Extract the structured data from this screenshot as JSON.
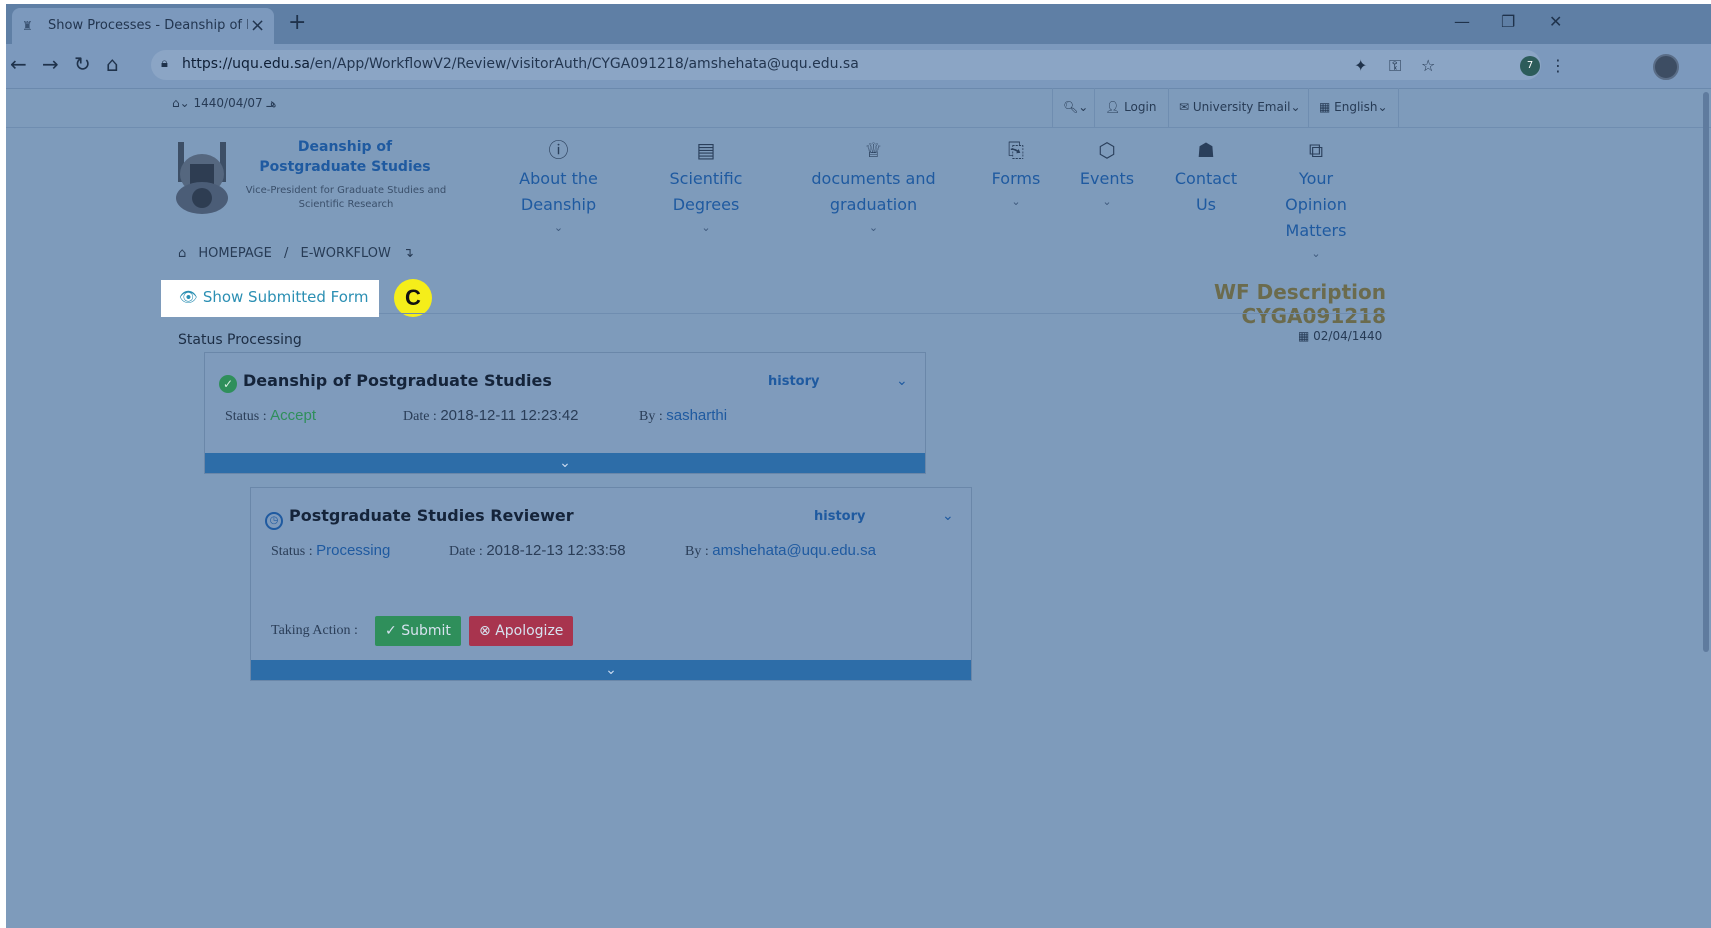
{
  "browser": {
    "tab_title": "Show Processes - Deanship of Po",
    "url_domain": "https://uqu.edu.sa",
    "url_path": "/en/App/WorkflowV2/Review/visitorAuth/CYGA091218/amshehata@uqu.edu.sa",
    "extension_badge": "7"
  },
  "topbar": {
    "hijri_date": "1440/04/07 هـ",
    "login": "Login",
    "university_email": "University Email",
    "language": "English"
  },
  "org": {
    "title": "Deanship of Postgraduate Studies",
    "subtitle": "Vice-President for Graduate Studies and Scientific Research"
  },
  "nav": [
    {
      "label": "About the Deanship",
      "icon": "info-icon"
    },
    {
      "label": "Scientific Degrees",
      "icon": "book-icon"
    },
    {
      "label": "documents and graduation",
      "icon": "trophy-icon"
    },
    {
      "label": "Forms",
      "icon": "files-icon"
    },
    {
      "label": "Events",
      "icon": "hexagon-icon"
    },
    {
      "label": "Contact Us",
      "icon": "android-icon"
    },
    {
      "label": "Your Opinion Matters",
      "icon": "copy-icon"
    }
  ],
  "breadcrumb": {
    "home": "HOMEPAGE",
    "sep": "/",
    "current": "E-WORKFLOW"
  },
  "show_form_label": "Show Submitted Form",
  "annotation_badge": "C",
  "wf_title": "WF Description CYGA091218",
  "status_label": "Status Processing",
  "created_date": "02/04/1440",
  "cards": [
    {
      "title": "Deanship of Postgraduate Studies",
      "history": "history",
      "status_key": "Status :",
      "status_val": "Accept",
      "date_key": "Date :",
      "date_val": "2018-12-11 12:23:42",
      "by_key": "By :",
      "by_val": "sasharthi"
    },
    {
      "title": "Postgraduate Studies Reviewer",
      "history": "history",
      "status_key": "Status :",
      "status_val": "Processing",
      "date_key": "Date :",
      "date_val": "2018-12-13 12:33:58",
      "by_key": "By :",
      "by_val": "amshehata@uqu.edu.sa",
      "action_label": "Taking Action :",
      "submit": "Submit",
      "apologize": "Apologize"
    }
  ],
  "colors": {
    "accept": "#2f8f5b",
    "processing": "#1f5aa0",
    "submit": "#2f8f5b",
    "apologize": "#a8344e",
    "bar": "#2d6da8"
  }
}
